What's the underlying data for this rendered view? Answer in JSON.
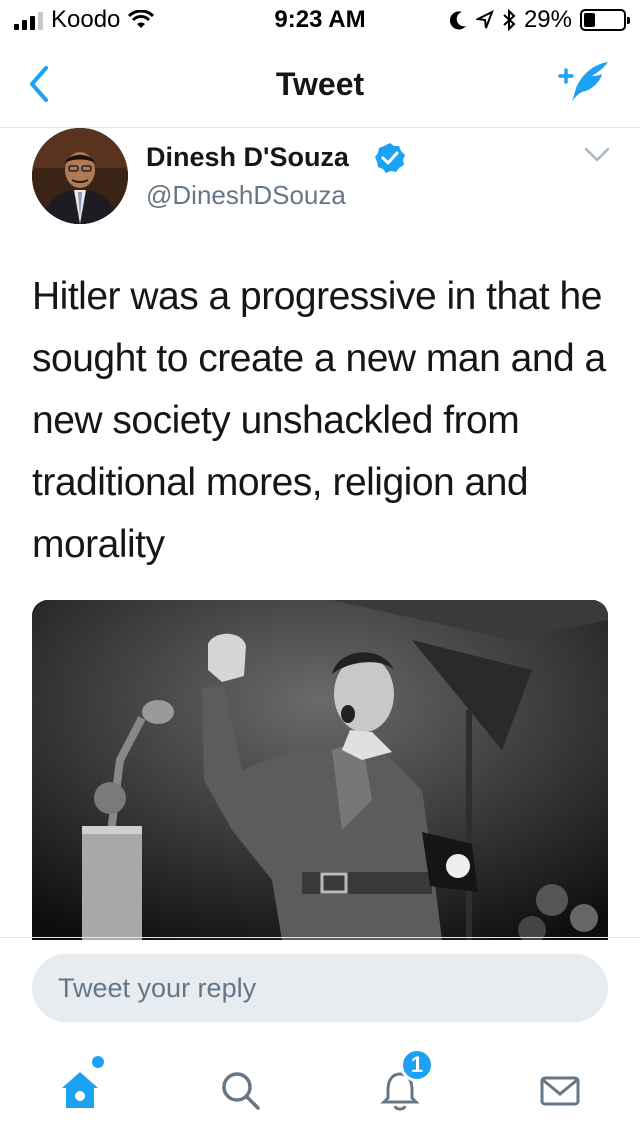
{
  "status_bar": {
    "carrier": "Koodo",
    "time": "9:23 AM",
    "battery_percent": "29%",
    "battery_level": 0.29,
    "icons": [
      "signal-icon",
      "wifi-icon",
      "moon-icon",
      "location-icon",
      "bluetooth-icon",
      "battery-icon"
    ]
  },
  "nav": {
    "title": "Tweet",
    "back_icon": "chevron-left-icon",
    "compose_icon": "compose-tweet-icon"
  },
  "tweet": {
    "author_name": "Dinesh D'Souza",
    "verified": true,
    "handle": "@DineshDSouza",
    "text": "Hitler was a progressive in that he sought to create a new man and a new society unshackled from traditional mores, religion and morality",
    "media_icon": "photo"
  },
  "reply": {
    "placeholder": "Tweet your reply"
  },
  "tab_bar": {
    "tabs": [
      {
        "name": "home",
        "icon": "home-icon",
        "active": true
      },
      {
        "name": "search",
        "icon": "search-icon",
        "active": false
      },
      {
        "name": "notifications",
        "icon": "bell-icon",
        "active": false,
        "badge": "1"
      },
      {
        "name": "messages",
        "icon": "envelope-icon",
        "active": false
      }
    ]
  },
  "colors": {
    "accent": "#1da1f2",
    "text_primary": "#14171a",
    "text_secondary": "#657786",
    "reply_bg": "#e6ecf0",
    "divider": "#e1e8ed"
  }
}
